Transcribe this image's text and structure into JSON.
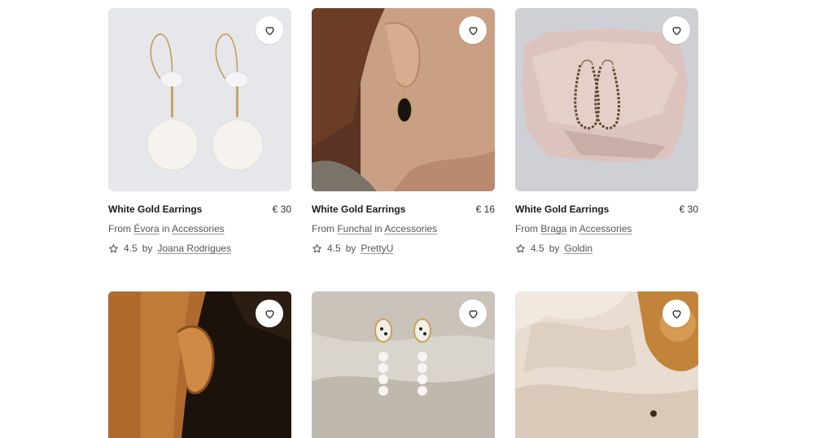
{
  "products": [
    {
      "title": "White Gold Earrings",
      "price": "€ 30",
      "from_prefix": "From",
      "location": "Évora",
      "in_word": "in",
      "category": "Accessories",
      "rating": "4.5",
      "by_word": "by",
      "seller": "Joana Rodrigues",
      "image_icon": "earrings-gold-disc-photo"
    },
    {
      "title": "White Gold Earrings",
      "price": "€ 16",
      "from_prefix": "From",
      "location": "Funchal",
      "in_word": "in",
      "category": "Accessories",
      "rating": "4.5",
      "by_word": "by",
      "seller": "PrettyU",
      "image_icon": "ear-with-black-drop-earring-photo"
    },
    {
      "title": "White Gold Earrings",
      "price": "€ 30",
      "from_prefix": "From",
      "location": "Braga",
      "in_word": "in",
      "category": "Accessories",
      "rating": "4.5",
      "by_word": "by",
      "seller": "Goldin",
      "image_icon": "filigree-earrings-on-quartz-photo"
    }
  ],
  "second_row_images": [
    "ear-close-up-photo",
    "pearl-drop-earrings-photo",
    "earrings-on-fabric-photo"
  ],
  "colors": {
    "card_bg_1": "#e7e8ec",
    "card_bg_3": "#cfd0d6",
    "text": "#1a1a1a",
    "muted": "#555555"
  }
}
